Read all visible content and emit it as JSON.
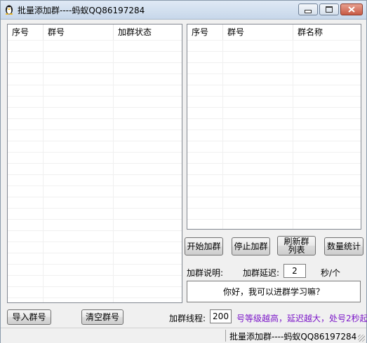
{
  "window": {
    "title": "批量添加群----蚂蚁QQ86197284",
    "icon": "penguin-icon"
  },
  "left_list": {
    "columns": [
      "序号",
      "群号",
      "加群状态"
    ],
    "rows": []
  },
  "right_list": {
    "columns": [
      "序号",
      "群号",
      "群名称"
    ],
    "rows": []
  },
  "buttons": {
    "start": "开始加群",
    "stop": "停止加群",
    "refresh": "刷新群列表",
    "stats": "数量统计",
    "import": "导入群号",
    "clear": "清空群号"
  },
  "settings": {
    "desc_label": "加群说明:",
    "delay_label": "加群延迟:",
    "delay_value": "2",
    "delay_unit": "秒/个",
    "message": "你好，我可以进群学习嘛？",
    "threads_label": "加群线程:",
    "threads_value": "200",
    "hint": "号等级越高，延迟越大，处号2秒起"
  },
  "status_bar": {
    "text": "批量添加群----蚂蚁QQ86197284"
  }
}
